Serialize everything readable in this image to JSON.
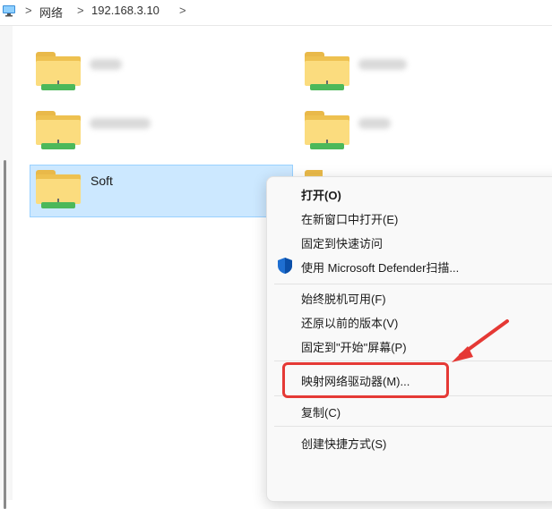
{
  "address_bar": {
    "icon": "computer-icon",
    "separator": ">",
    "crumbs": [
      "网络",
      "192.168.3.10"
    ]
  },
  "folders": [
    {
      "name": "",
      "icon": "network-folder-icon",
      "blurred": true
    },
    {
      "name": "",
      "icon": "network-folder-icon",
      "blurred": true
    },
    {
      "name": "",
      "icon": "network-folder-icon",
      "blurred": true
    },
    {
      "name": "",
      "icon": "network-folder-icon",
      "blurred": true
    },
    {
      "name": "Soft",
      "icon": "network-folder-icon",
      "selected": true
    },
    {
      "name": "",
      "icon": "network-folder-icon",
      "blurred": true
    }
  ],
  "context_menu": {
    "items": [
      {
        "label": "打开(O)",
        "bold": true
      },
      {
        "label": "在新窗口中打开(E)"
      },
      {
        "label": "固定到快速访问"
      },
      {
        "label": "使用 Microsoft Defender扫描...",
        "icon": "defender-shield-icon"
      },
      {
        "label": "始终脱机可用(F)"
      },
      {
        "label": "还原以前的版本(V)"
      },
      {
        "label": "固定到\"开始\"屏幕(P)"
      },
      {
        "label": "映射网络驱动器(M)...",
        "highlighted": true
      },
      {
        "label": "复制(C)"
      },
      {
        "label": "创建快捷方式(S)"
      }
    ]
  },
  "annotation": {
    "highlight_color": "#e53935",
    "arrow_color": "#e53935"
  },
  "colors": {
    "selection_bg": "#cce8ff",
    "selection_border": "#99d1ff",
    "folder_yellow": "#fbdc7e",
    "network_green": "#4cb85a"
  }
}
